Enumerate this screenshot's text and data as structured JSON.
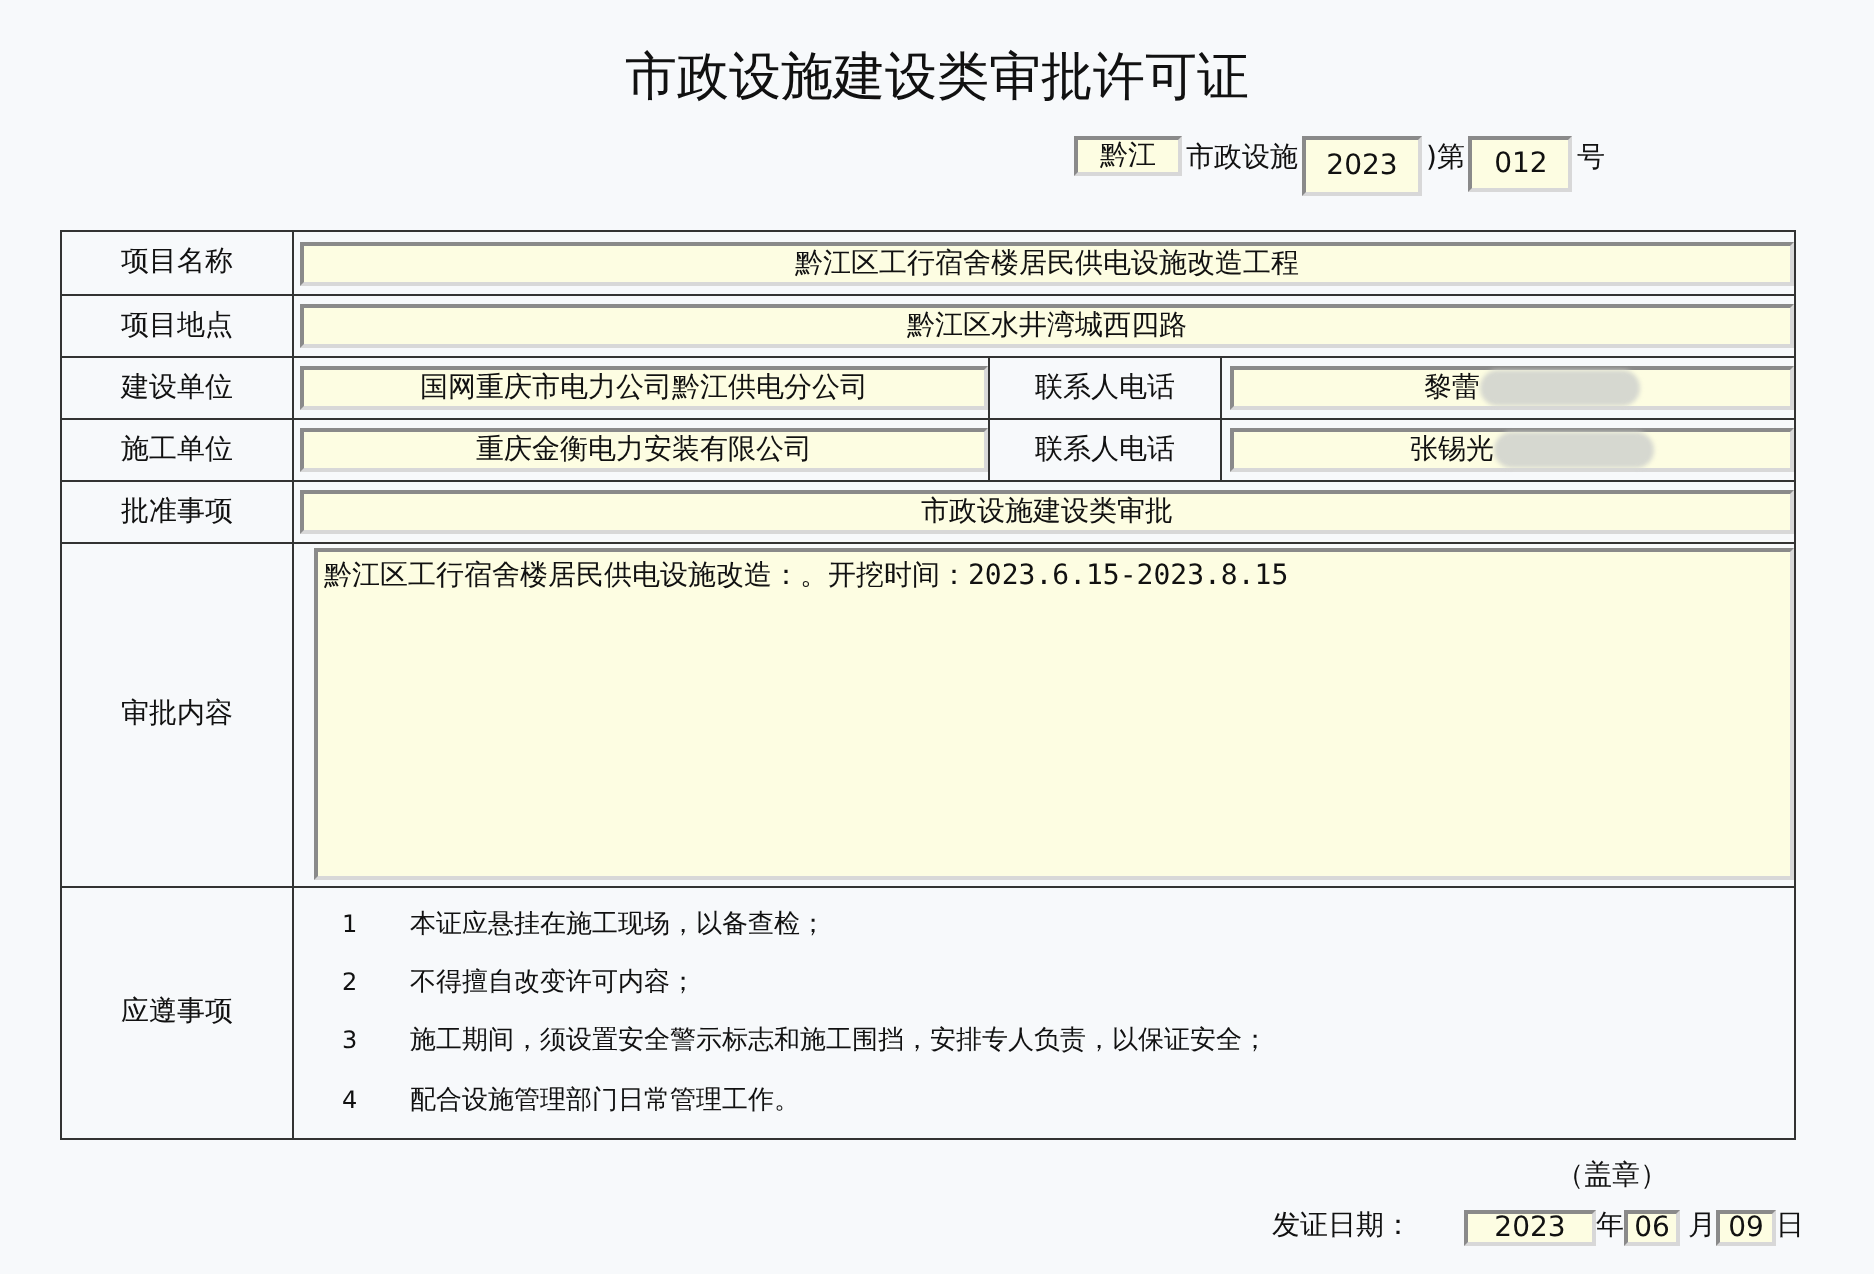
{
  "title": "市政设施建设类审批许可证",
  "number": {
    "district": "黔江",
    "prefix": "市政设施",
    "year": "2023",
    "middle": ")第",
    "serial": "012",
    "suffix": "号"
  },
  "rows": [
    {
      "kind": "single",
      "label": "项目名称",
      "value": "黔江区工行宿舍楼居民供电设施改造工程"
    },
    {
      "kind": "single",
      "label": "项目地点",
      "value": "黔江区水井湾城西四路"
    },
    {
      "kind": "pair",
      "label": "建设单位",
      "value": "国网重庆市电力公司黔江供电分公司",
      "label_2": "联系人电话",
      "value_2": "黎蕾",
      "redacted": true
    },
    {
      "kind": "pair",
      "label": "施工单位",
      "value": "重庆金衡电力安装有限公司",
      "label_2": "联系人电话",
      "value_2": "张锡光",
      "redacted": true
    },
    {
      "kind": "single",
      "label": "批准事项",
      "value": "市政设施建设类审批"
    },
    {
      "kind": "text",
      "label": "审批内容",
      "value": "黔江区工行宿舍楼居民供电设施改造：。开挖时间：2023.6.15-2023.8.15"
    },
    {
      "kind": "list",
      "label": "应遵事项",
      "items": [
        {
          "number": "1",
          "text": "本证应悬挂在施工现场，以备查检；"
        },
        {
          "number": "2",
          "text": "不得擅自改变许可内容；"
        },
        {
          "number": "3",
          "text": "施工期间，须设置安全警示标志和施工围挡，安排专人负责，以保证安全；"
        },
        {
          "number": "4",
          "text": "配合设施管理部门日常管理工作。"
        }
      ]
    }
  ],
  "seal": "（盖章）",
  "issue_date": {
    "label": "发证日期：",
    "year": "2023",
    "year_unit": "年",
    "month": "06",
    "month_unit": "月",
    "day": "09",
    "day_unit": "日"
  }
}
